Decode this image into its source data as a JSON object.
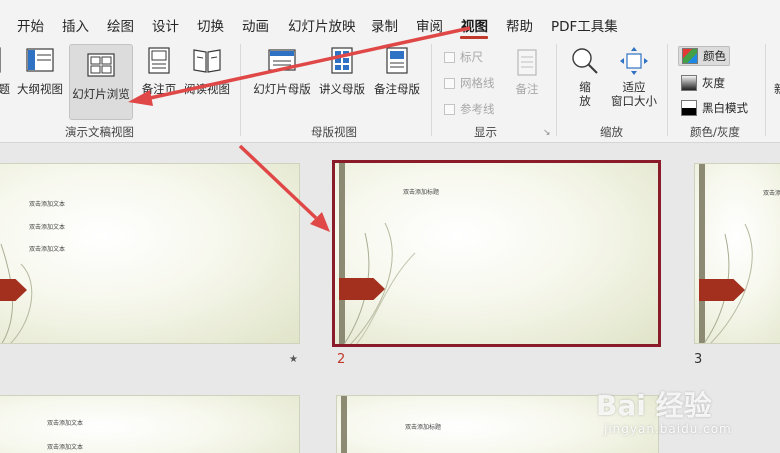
{
  "tabs": [
    "开始",
    "插入",
    "绘图",
    "设计",
    "切换",
    "动画",
    "幻灯片放映",
    "录制",
    "审阅",
    "视图",
    "帮助",
    "PDF工具集"
  ],
  "active_tab": "视图",
  "ribbon": {
    "presentation_views": {
      "label": "演示文稿视图",
      "buttons": [
        {
          "label": "题",
          "icon": "normal-view-icon"
        },
        {
          "label": "大纲视图",
          "icon": "outline-view-icon"
        },
        {
          "label": "幻灯片浏览",
          "icon": "slide-sorter-icon",
          "selected": true
        },
        {
          "label": "备注页",
          "icon": "notes-page-icon"
        },
        {
          "label": "阅读视图",
          "icon": "reading-view-icon"
        }
      ]
    },
    "master_views": {
      "label": "母版视图",
      "buttons": [
        {
          "label": "幻灯片母版",
          "icon": "slide-master-icon"
        },
        {
          "label": "讲义母版",
          "icon": "handout-master-icon"
        },
        {
          "label": "备注母版",
          "icon": "notes-master-icon"
        }
      ]
    },
    "show": {
      "label": "显示",
      "checkboxes": [
        "标尺",
        "网格线",
        "参考线"
      ],
      "notes_label": "备注",
      "launcher": "↘"
    },
    "zoom": {
      "label": "缩放",
      "zoom_label_line1": "缩",
      "zoom_label_line2": "放",
      "fit_label_line1": "适应",
      "fit_label_line2": "窗口大小"
    },
    "color": {
      "label": "颜色/灰度",
      "options": [
        "颜色",
        "灰度",
        "黑白模式"
      ],
      "selected": "颜色"
    },
    "overflow_label": "新"
  },
  "slides": [
    {
      "number": "",
      "mark": "★",
      "text_lines": [
        "双击添加文本",
        "双击添加文本",
        "双击添加文本"
      ]
    },
    {
      "number": "2",
      "selected": true,
      "text_lines": [
        "双击添加标题"
      ]
    },
    {
      "number": "3",
      "text_lines": [
        "双击添加标题"
      ]
    },
    {
      "number": "",
      "text_lines": [
        "双击添加文本",
        "双击添加文本"
      ]
    },
    {
      "number": "",
      "text_lines": [
        "双击添加标题"
      ]
    }
  ],
  "watermark": {
    "main": "Bai 经验",
    "sub": "jingyan.baidu.com"
  },
  "colors": {
    "accent": "#c0392b",
    "selection": "#8a1c2a",
    "arrow": "#e04848",
    "slide_arrow": "#a3301e"
  }
}
